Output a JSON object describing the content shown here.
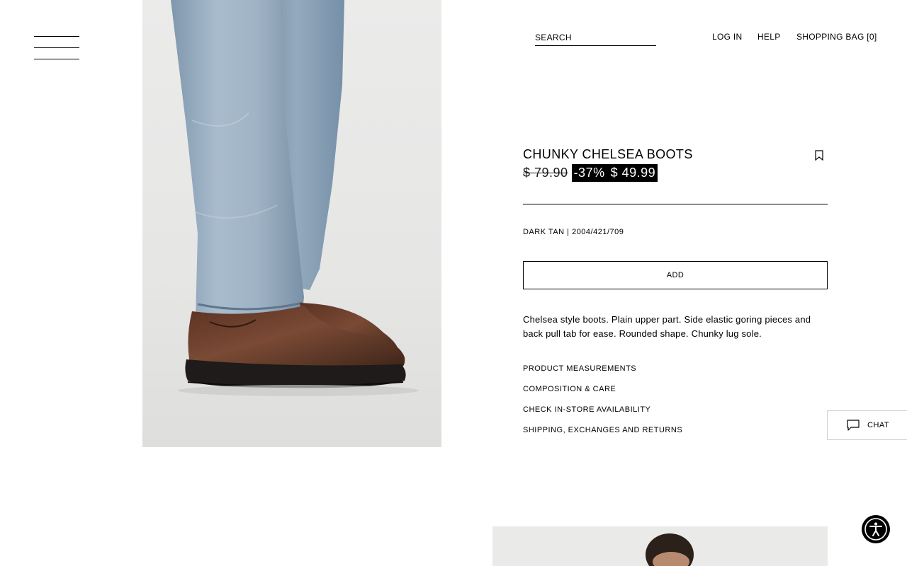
{
  "header": {
    "search_placeholder": "SEARCH",
    "login_label": "LOG IN",
    "help_label": "HELP",
    "bag_label": "SHOPPING BAG [0]"
  },
  "product": {
    "title": "CHUNKY CHELSEA BOOTS",
    "old_price": "$ 79.90",
    "discount": "-37%",
    "sale_price": "$ 49.99",
    "color_ref": "DARK TAN | 2004/421/709",
    "add_label": "ADD",
    "description": "Chelsea style boots. Plain upper part. Side elastic goring pieces and back pull tab for ease. Rounded shape. Chunky lug sole.",
    "links": [
      "PRODUCT MEASUREMENTS",
      "COMPOSITION & CARE",
      "CHECK IN-STORE AVAILABILITY",
      "SHIPPING, EXCHANGES AND RETURNS"
    ]
  },
  "chat": {
    "label": "CHAT"
  },
  "icons": {
    "menu": "hamburger-icon",
    "bookmark": "bookmark-icon",
    "chat": "chat-bubble-icon",
    "accessibility": "accessibility-icon"
  }
}
